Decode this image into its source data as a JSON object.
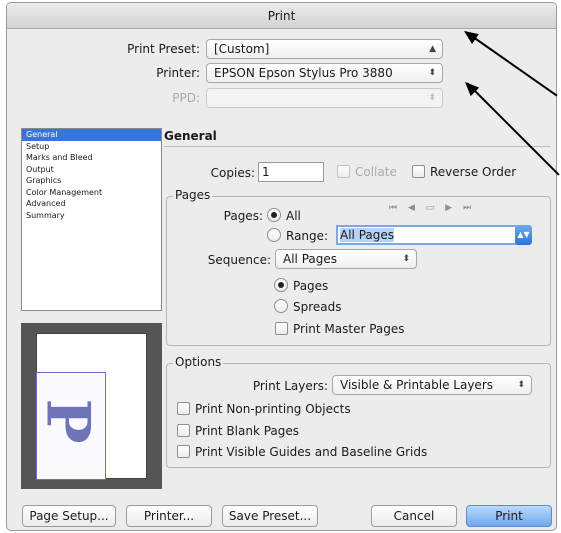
{
  "window": {
    "title": "Print"
  },
  "top": {
    "print_preset_label": "Print Preset:",
    "print_preset_value": "[Custom]",
    "printer_label": "Printer:",
    "printer_value": "EPSON Epson Stylus Pro 3880",
    "ppd_label": "PPD:",
    "ppd_value": ""
  },
  "sidebar": {
    "items": [
      {
        "label": "General",
        "selected": true
      },
      {
        "label": "Setup"
      },
      {
        "label": "Marks and Bleed"
      },
      {
        "label": "Output"
      },
      {
        "label": "Graphics"
      },
      {
        "label": "Color Management"
      },
      {
        "label": "Advanced"
      },
      {
        "label": "Summary"
      }
    ]
  },
  "general": {
    "title": "General",
    "copies_label": "Copies:",
    "copies_value": "1",
    "collate_label": "Collate",
    "reverse_label": "Reverse Order"
  },
  "pages": {
    "group_title": "Pages",
    "pages_label": "Pages:",
    "all_label": "All",
    "range_label": "Range:",
    "range_value": "All Pages",
    "sequence_label": "Sequence:",
    "sequence_value": "All Pages",
    "pages_radio_label": "Pages",
    "spreads_radio_label": "Spreads",
    "print_master_label": "Print Master Pages"
  },
  "options": {
    "group_title": "Options",
    "print_layers_label": "Print Layers:",
    "print_layers_value": "Visible & Printable Layers",
    "non_printing_label": "Print Non-printing Objects",
    "blank_pages_label": "Print Blank Pages",
    "guides_label": "Print Visible Guides and Baseline Grids"
  },
  "buttons": {
    "page_setup": "Page Setup...",
    "printer": "Printer...",
    "save_preset": "Save Preset...",
    "cancel": "Cancel",
    "print": "Print"
  },
  "preview": {
    "glyph": "P"
  },
  "icons": {
    "popup_arrows": "↕",
    "nav_first": "⏮",
    "nav_prev": "◀",
    "nav_spread": "spread-icon",
    "nav_next": "▶",
    "nav_last": "⏭"
  },
  "colors": {
    "selection": "#3875d7",
    "default_button": "#6fa8ec",
    "bleed_outline": "#6d6dc9",
    "preview_glyph": "#6f74b8"
  }
}
